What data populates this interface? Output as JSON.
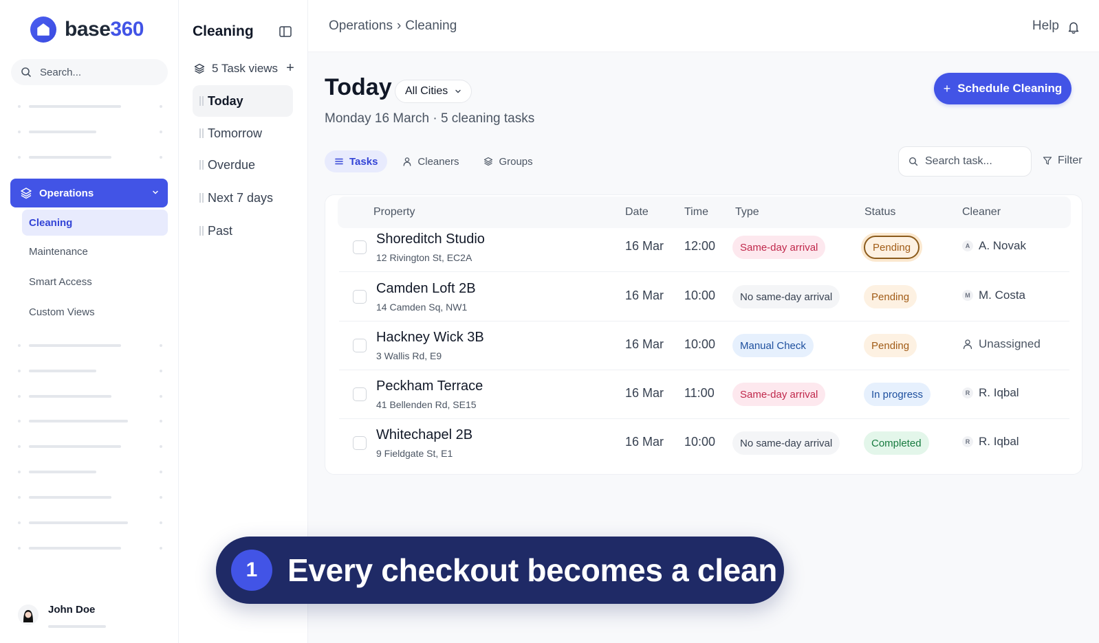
{
  "brand": {
    "prefix": "base",
    "suffix": "360",
    "accent": "#4254e6"
  },
  "sidebar": {
    "search_placeholder": "Search...",
    "section": "Operations",
    "subitems": [
      {
        "label": "Cleaning",
        "active": true
      },
      {
        "label": "Maintenance"
      },
      {
        "label": "Smart Access"
      },
      {
        "label": "Custom Views"
      }
    ],
    "user": {
      "name": "John Doe"
    }
  },
  "panel": {
    "title": "Cleaning",
    "views_label": "5 Task views",
    "views": [
      {
        "label": "Today",
        "active": true
      },
      {
        "label": "Tomorrow"
      },
      {
        "label": "Overdue"
      },
      {
        "label": "Next 7 days"
      },
      {
        "label": "Past"
      }
    ]
  },
  "topbar": {
    "crumb_root": "Operations",
    "crumb_sep": "›",
    "crumb_current": "Cleaning",
    "help": "Help"
  },
  "main": {
    "title": "Today",
    "city_filter": "All Cities",
    "subtitle": "Monday 16 March · 5 cleaning tasks",
    "cta": "Schedule Cleaning",
    "tabs": [
      {
        "label": "Tasks",
        "icon": "list-icon",
        "active": true
      },
      {
        "label": "Cleaners",
        "icon": "user-icon"
      },
      {
        "label": "Groups",
        "icon": "layers-icon"
      }
    ],
    "task_search_placeholder": "Search task...",
    "filter": "Filter"
  },
  "table": {
    "columns": [
      "Property",
      "Date",
      "Time",
      "Type",
      "Status",
      "Cleaner"
    ],
    "rows": [
      {
        "name": "Shoreditch Studio",
        "address": "12 Rivington St, EC2A",
        "date": "16 Mar",
        "time": "12:00",
        "type": "Same-day arrival",
        "status": "Pending",
        "initial": "A",
        "cleaner": "A. Novak"
      },
      {
        "name": "Camden Loft 2B",
        "address": "14 Camden Sq, NW1",
        "date": "16 Mar",
        "time": "10:00",
        "type": "No same-day arrival",
        "status": "Pending",
        "initial": "M",
        "cleaner": "M. Costa"
      },
      {
        "name": "Hackney Wick 3B",
        "address": "3 Wallis Rd, E9",
        "date": "16 Mar",
        "time": "10:00",
        "type": "Manual Check",
        "status": "Pending",
        "initial": "",
        "cleaner": "Unassigned"
      },
      {
        "name": "Peckham Terrace",
        "address": "41 Bellenden Rd, SE15",
        "date": "16 Mar",
        "time": "11:00",
        "type": "Same-day arrival",
        "status": "In progress",
        "initial": "R",
        "cleaner": "R. Iqbal"
      },
      {
        "name": "Whitechapel 2B",
        "address": "9 Fieldgate St, E1",
        "date": "16 Mar",
        "time": "10:00",
        "type": "No same-day arrival",
        "status": "Completed",
        "initial": "R",
        "cleaner": "R. Iqbal"
      }
    ]
  },
  "callout": {
    "step": "1",
    "text": "Every checkout becomes a clean"
  }
}
